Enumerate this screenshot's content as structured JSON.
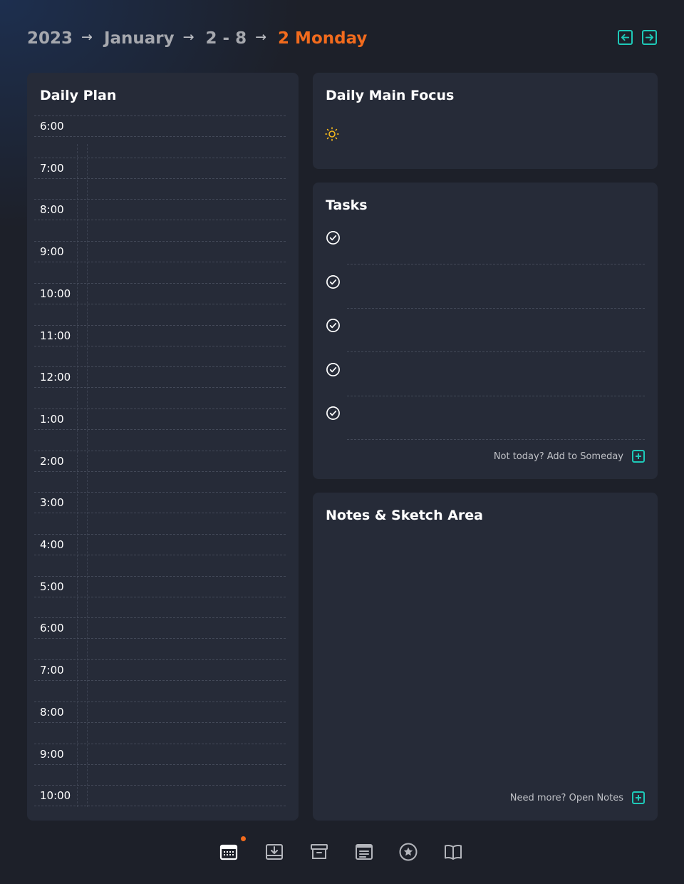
{
  "breadcrumb": {
    "year": "2023",
    "month": "January",
    "week": "2 - 8",
    "day": "2 Monday",
    "arrow": "→"
  },
  "colors": {
    "accent": "#1ec9b8",
    "current": "#f26b1d",
    "panel": "#262b38",
    "background": "#1d2029",
    "sun": "#f5b91e"
  },
  "nav": {
    "prev_icon": "arrow-left-box-icon",
    "next_icon": "arrow-right-box-icon"
  },
  "daily_plan": {
    "title": "Daily Plan",
    "times": [
      "6:00",
      "7:00",
      "8:00",
      "9:00",
      "10:00",
      "11:00",
      "12:00",
      "1:00",
      "2:00",
      "3:00",
      "4:00",
      "5:00",
      "6:00",
      "7:00",
      "8:00",
      "9:00",
      "10:00"
    ]
  },
  "focus": {
    "title": "Daily Main Focus",
    "icon": "sun-icon"
  },
  "tasks": {
    "title": "Tasks",
    "items": [
      "",
      "",
      "",
      "",
      ""
    ],
    "footer": "Not today? Add to Someday"
  },
  "notes": {
    "title": "Notes & Sketch Area",
    "footer": "Need more? Open Notes"
  },
  "bottom_nav": {
    "items": [
      "calendar-icon",
      "inbox-download-icon",
      "archive-icon",
      "notes-list-icon",
      "star-circle-icon",
      "book-icon"
    ],
    "active": "calendar-icon"
  }
}
